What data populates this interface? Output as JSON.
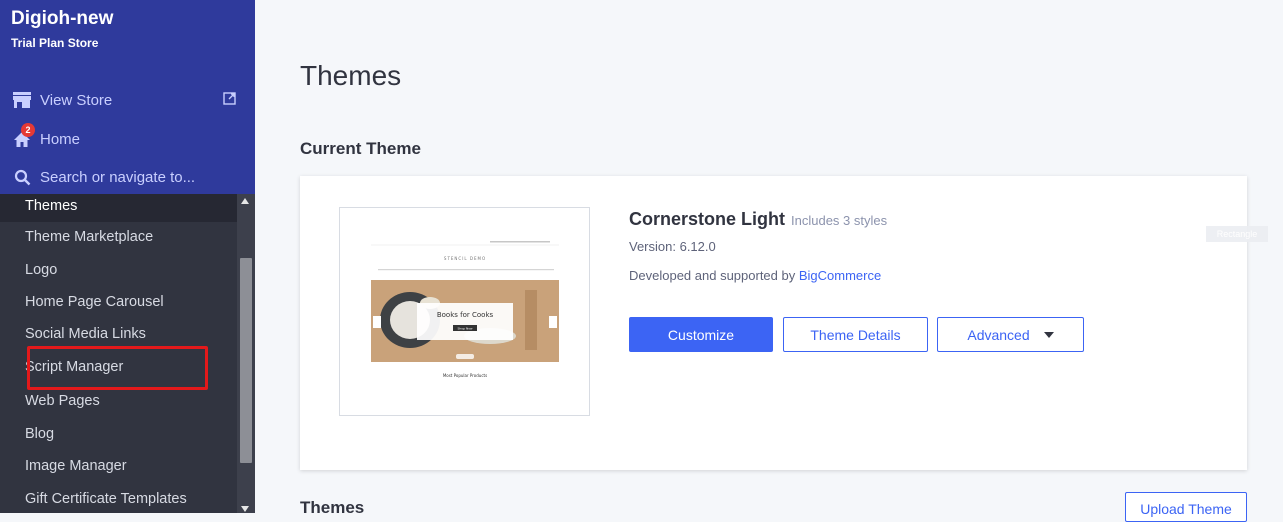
{
  "sidebar": {
    "store_name": "Digioh-new",
    "plan": "Trial Plan Store",
    "view_store": "View Store",
    "home": "Home",
    "home_badge": "2",
    "search_placeholder": "Search or navigate to...",
    "items": [
      {
        "label": "Themes"
      },
      {
        "label": "Theme Marketplace"
      },
      {
        "label": "Logo"
      },
      {
        "label": "Home Page Carousel"
      },
      {
        "label": "Social Media Links"
      },
      {
        "label": "Script Manager"
      },
      {
        "label": "Web Pages"
      },
      {
        "label": "Blog"
      },
      {
        "label": "Image Manager"
      },
      {
        "label": "Gift Certificate Templates"
      }
    ]
  },
  "main": {
    "page_title": "Themes",
    "current_theme_heading": "Current Theme",
    "theme": {
      "name": "Cornerstone Light",
      "styles": "Includes 3 styles",
      "version": "Version: 6.12.0",
      "developer_prefix": "Developed and supported by ",
      "developer": "BigCommerce",
      "thumbnail": {
        "store_title": "STENCIL DEMO",
        "hero_text": "Books for Cooks",
        "hero_button": "Shop Now",
        "popular": "Most Popular Products"
      }
    },
    "buttons": {
      "customize": "Customize",
      "details": "Theme Details",
      "advanced": "Advanced"
    },
    "overlay_tag": "Rectangle",
    "themes_heading": "Themes",
    "upload": "Upload Theme"
  },
  "colors": {
    "sidebar_head": "#2f3a9c",
    "sidebar_body": "#313440",
    "primary": "#3c64f4",
    "highlight": "#e3191b"
  }
}
